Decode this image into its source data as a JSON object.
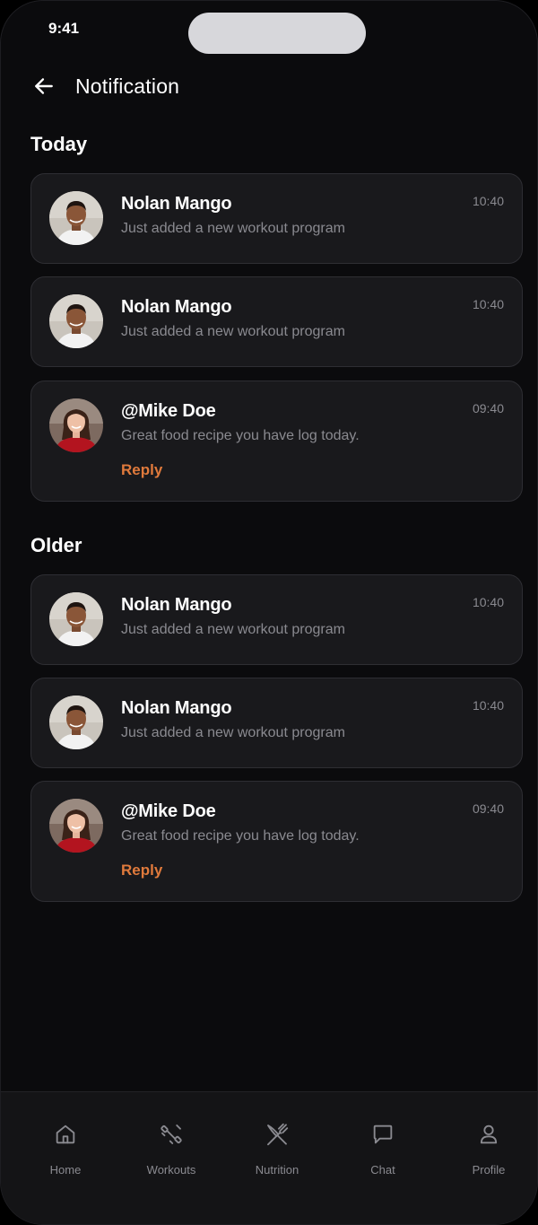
{
  "status_bar": {
    "time": "9:41"
  },
  "header": {
    "title": "Notification"
  },
  "sections": [
    {
      "title": "Today",
      "items": [
        {
          "name": "Nolan Mango",
          "message": "Just added a new workout program",
          "time": "10:40",
          "avatar": "man-avatar"
        },
        {
          "name": "Nolan Mango",
          "message": "Just added a new workout program",
          "time": "10:40",
          "avatar": "man-avatar"
        },
        {
          "name": "@Mike Doe",
          "message": "Great food recipe you have log today.",
          "time": "09:40",
          "avatar": "woman-avatar",
          "reply": "Reply"
        }
      ]
    },
    {
      "title": "Older",
      "items": [
        {
          "name": "Nolan Mango",
          "message": "Just added a new workout program",
          "time": "10:40",
          "avatar": "man-avatar"
        },
        {
          "name": "Nolan Mango",
          "message": "Just added a new workout program",
          "time": "10:40",
          "avatar": "man-avatar"
        },
        {
          "name": "@Mike Doe",
          "message": "Great food recipe you have log today.",
          "time": "09:40",
          "avatar": "woman-avatar",
          "reply": "Reply"
        }
      ]
    }
  ],
  "tabbar": {
    "items": [
      {
        "label": "Home",
        "icon": "home-icon"
      },
      {
        "label": "Workouts",
        "icon": "dumbbell-icon"
      },
      {
        "label": "Nutrition",
        "icon": "fork-knife-icon"
      },
      {
        "label": "Chat",
        "icon": "chat-icon"
      },
      {
        "label": "Profile",
        "icon": "user-icon"
      }
    ]
  },
  "colors": {
    "background": "#0b0b0d",
    "card": "#19191c",
    "card_border": "#2e2e33",
    "text_primary": "#ffffff",
    "text_secondary": "#8a8a90",
    "accent": "#e07a3c"
  }
}
